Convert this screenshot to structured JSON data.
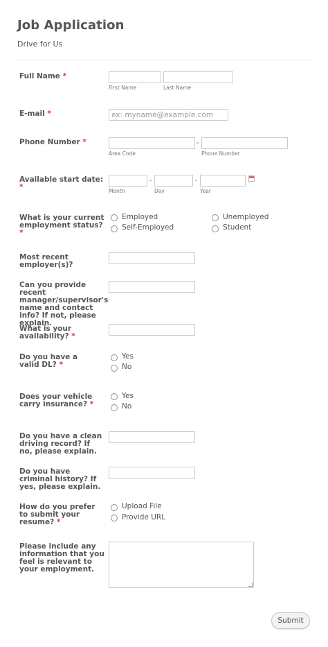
{
  "header": {
    "title": "Job Application",
    "subtitle": "Drive for Us"
  },
  "required_mark": "*",
  "full_name": {
    "label": "Full Name",
    "first_label": "First Name",
    "last_label": "Last Name"
  },
  "email": {
    "label": "E-mail",
    "placeholder": "ex: myname@example.com"
  },
  "phone": {
    "label": "Phone Number",
    "separator": "-",
    "area_label": "Area Code",
    "number_label": "Phone Number"
  },
  "start_date": {
    "label": "Available start date:",
    "separator": "-",
    "month_label": "Month",
    "day_label": "Day",
    "year_label": "Year",
    "icon": "calendar-icon"
  },
  "employment": {
    "label": "What is your current employment status?",
    "options": [
      "Employed",
      "Unemployed",
      "Self-Employed",
      "Student"
    ]
  },
  "employer": {
    "label": "Most recent employer(s)?"
  },
  "manager": {
    "label": "Can you provide recent manager/supervisor's name and contact info? If not, please explain."
  },
  "availability": {
    "label": "What is your availability?"
  },
  "dl": {
    "label": "Do you have a valid DL?",
    "options": [
      "Yes",
      "No"
    ]
  },
  "insurance": {
    "label": "Does your vehicle carry insurance?",
    "options": [
      "Yes",
      "No"
    ]
  },
  "driving_record": {
    "label": "Do you have a clean driving record? If no, please explain."
  },
  "criminal": {
    "label": "Do you have criminal history? If yes, please explain."
  },
  "resume": {
    "label": "How do you prefer to submit your resume?",
    "options": [
      "Upload File",
      "Provide URL"
    ]
  },
  "additional": {
    "label": "Please include any information that you feel is relevant to your employment."
  },
  "submit": {
    "label": "Submit"
  },
  "colors": {
    "required": "#e03131",
    "text": "#555555",
    "border": "#c9c9c9"
  }
}
